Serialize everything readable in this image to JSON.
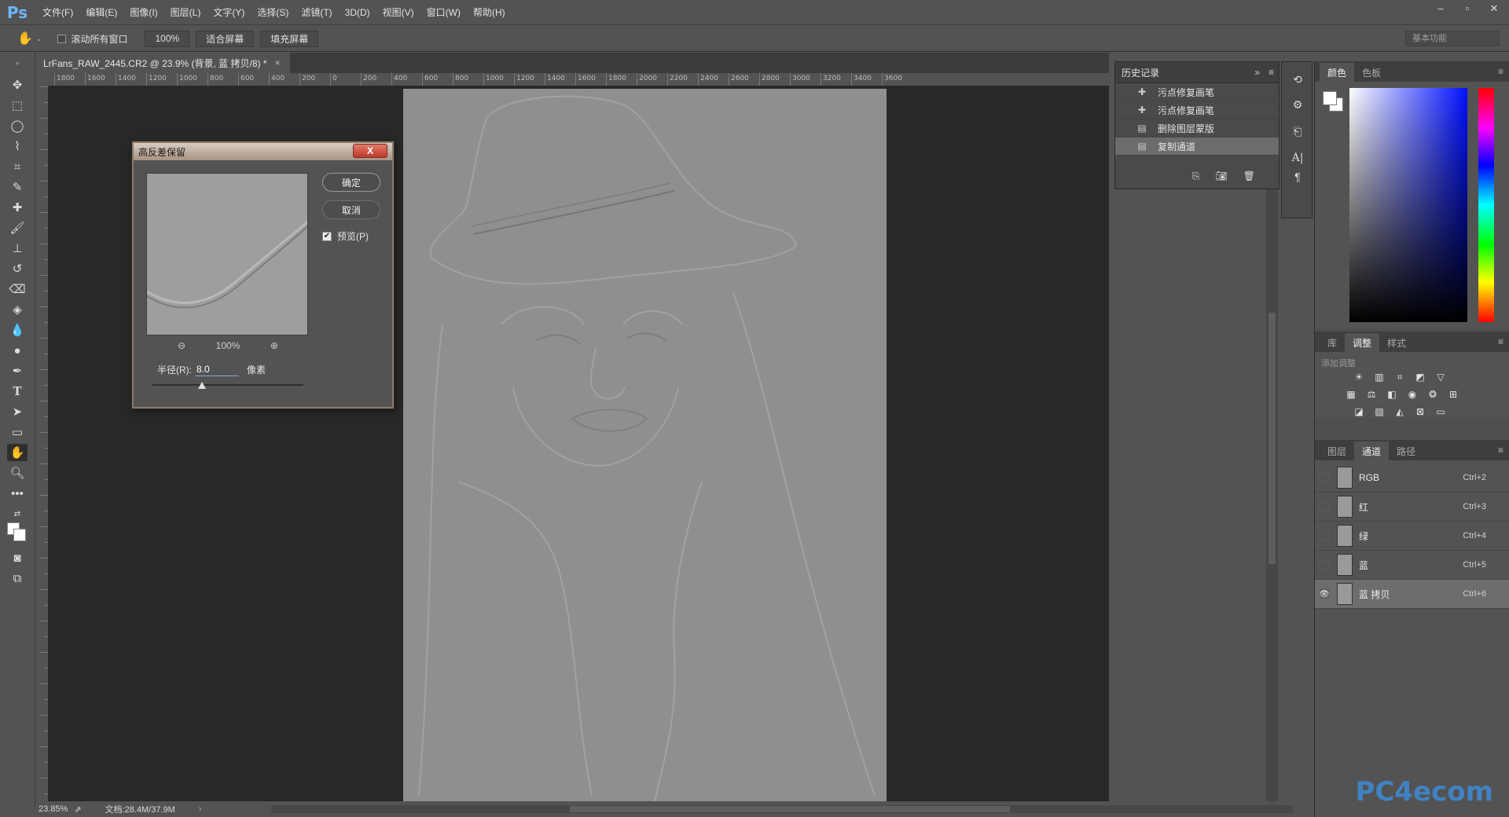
{
  "app": {
    "logo": "Ps"
  },
  "menu": [
    "文件(F)",
    "编辑(E)",
    "图像(I)",
    "图层(L)",
    "文字(Y)",
    "选择(S)",
    "滤镜(T)",
    "3D(D)",
    "视图(V)",
    "窗口(W)",
    "帮助(H)"
  ],
  "options": {
    "scroll_all": "滚动所有窗口",
    "zoom_100": "100%",
    "fit_screen": "适合屏幕",
    "fill_screen": "填充屏幕",
    "workspace": "基本功能"
  },
  "document": {
    "tab_title": "LrFans_RAW_2445.CR2 @ 23.9% (背景, 蓝 拷贝/8) *",
    "close": "×"
  },
  "ruler": {
    "h": [
      "1800",
      "1600",
      "1400",
      "1200",
      "1000",
      "800",
      "600",
      "400",
      "200",
      "0",
      "200",
      "400",
      "600",
      "800",
      "1000",
      "1200",
      "1400",
      "1600",
      "1800",
      "2000",
      "2200",
      "2400",
      "2600",
      "2800",
      "3000",
      "3200",
      "3400",
      "3600"
    ]
  },
  "status": {
    "zoom": "23.85%",
    "doc": "文档:28.4M/37.9M"
  },
  "history": {
    "title": "历史记录",
    "items": [
      {
        "label": "污点修复画笔",
        "icon": "bandage-icon"
      },
      {
        "label": "污点修复画笔",
        "icon": "bandage-icon"
      },
      {
        "label": "删除图层蒙版",
        "icon": "document-icon"
      },
      {
        "label": "复制通道",
        "icon": "document-icon"
      }
    ]
  },
  "color_panel": {
    "tabs": [
      "颜色",
      "色板"
    ]
  },
  "adjust_panel": {
    "tabs": [
      "库",
      "调整",
      "样式"
    ],
    "add_label": "添加调整"
  },
  "channels_panel": {
    "tabs": [
      "图层",
      "通道",
      "路径"
    ],
    "channels": [
      {
        "name": "RGB",
        "key": "Ctrl+2"
      },
      {
        "name": "红",
        "key": "Ctrl+3"
      },
      {
        "name": "绿",
        "key": "Ctrl+4"
      },
      {
        "name": "蓝",
        "key": "Ctrl+5"
      },
      {
        "name": "蓝 拷贝",
        "key": "Ctrl+6"
      }
    ]
  },
  "dialog": {
    "title": "高反差保留",
    "close": "X",
    "ok": "确定",
    "cancel": "取消",
    "preview": "预览(P)",
    "zoom": "100%",
    "radius_label": "半径(R):",
    "radius_value": "8.0",
    "radius_unit": "像素"
  },
  "watermark": "PC4ecom"
}
